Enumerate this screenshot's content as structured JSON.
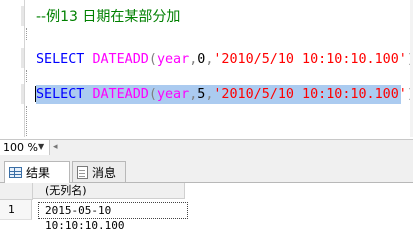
{
  "editor": {
    "comment": "--例13 日期在某部分加",
    "line1": {
      "keyword": "SELECT",
      "function": "DATEADD",
      "open": "(",
      "datepart": "year",
      "comma1": ",",
      "number": "0",
      "comma2": ",",
      "string": "'2010/5/10 10:10:10.100'",
      "close": ")"
    },
    "line2": {
      "keyword": "SELECT",
      "function": "DATEADD",
      "open": "(",
      "datepart": "year",
      "comma1": ",",
      "number": "5",
      "comma2": ",",
      "string": "'2010/5/10 10:10:10.100'",
      "close": ")"
    }
  },
  "zoom": {
    "value": "100 %"
  },
  "tabs": [
    {
      "label": "结果",
      "icon": "results-grid-icon",
      "active": true
    },
    {
      "label": "消息",
      "icon": "messages-icon",
      "active": false
    }
  ],
  "grid": {
    "columns": [
      "(无列名)"
    ],
    "rows": [
      {
        "row_number": "1",
        "values": [
          "2015-05-10 10:10:10.100"
        ]
      }
    ]
  },
  "colors": {
    "keyword": "#0000ff",
    "function": "#ff00ff",
    "string": "#ff0000",
    "comment": "#008000",
    "selection": "#abcbf0"
  }
}
